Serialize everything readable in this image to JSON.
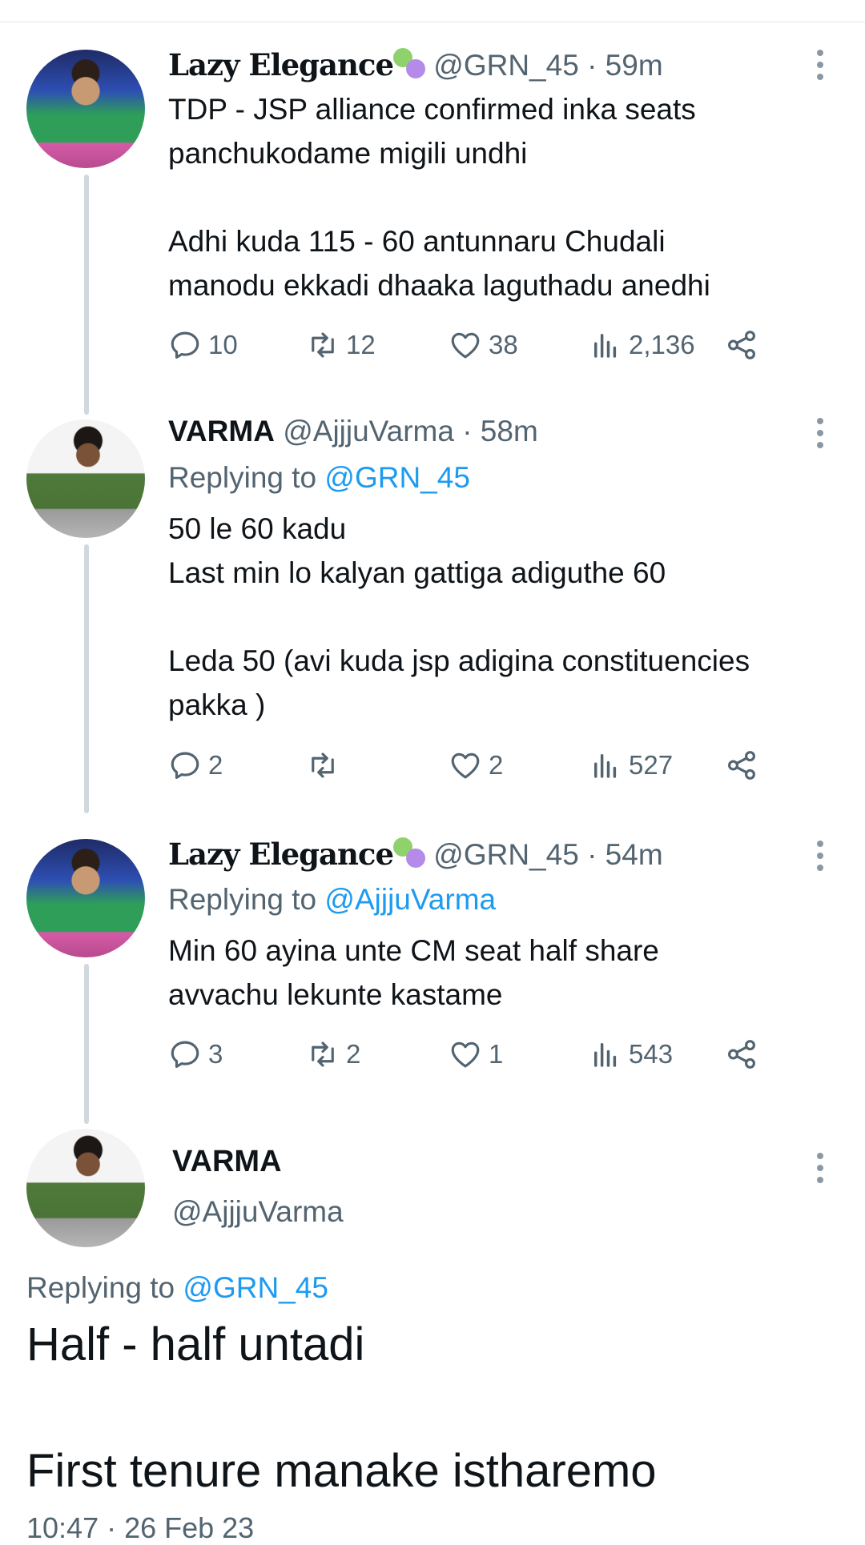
{
  "tweets": [
    {
      "name": "Lazy Elegance",
      "handle": "@GRN_45",
      "time": "· 59m",
      "replying_prefix": "",
      "replying_to": "",
      "text": "TDP - JSP alliance confirmed inka seats\npanchukodame migili undhi\n\nAdhi kuda 115 - 60 antunnaru Chudali\nmanodu ekkadi dhaaka laguthadu anedhi",
      "replies": "10",
      "retweets": "12",
      "likes": "38",
      "views": "2,136"
    },
    {
      "name": "VARMA",
      "handle": "@AjjjuVarma",
      "time": "· 58m",
      "replying_prefix": "Replying to",
      "replying_to": "@GRN_45",
      "text": "50 le 60 kadu\nLast min lo kalyan gattiga adiguthe 60\n\nLeda 50 (avi kuda jsp adigina constituencies\npakka )",
      "replies": "2",
      "retweets": "",
      "likes": "2",
      "views": "527"
    },
    {
      "name": "Lazy Elegance",
      "handle": "@GRN_45",
      "time": "· 54m",
      "replying_prefix": "Replying to",
      "replying_to": "@AjjjuVarma",
      "text": "Min 60 ayina unte CM seat half share\navvachu lekunte kastame",
      "replies": "3",
      "retweets": "2",
      "likes": "1",
      "views": "543"
    }
  ],
  "main_tweet": {
    "name": "VARMA",
    "handle": "@AjjjuVarma",
    "replying_prefix": "Replying to",
    "replying_to": "@GRN_45",
    "line1": "Half - half untadi",
    "line2": "First tenure manake istharemo",
    "timestamp": "10:47 · 26 Feb 23"
  },
  "icons": {
    "reply": "reply-icon",
    "retweet": "retweet-icon",
    "like": "heart-icon",
    "views": "views-icon",
    "share": "share-icon",
    "more": "more-icon",
    "name_emoji": "performing-arts-masks-icon"
  },
  "colors": {
    "link": "#1d9bf0",
    "secondary_text": "#536471",
    "thread_line": "#cfd9de"
  }
}
